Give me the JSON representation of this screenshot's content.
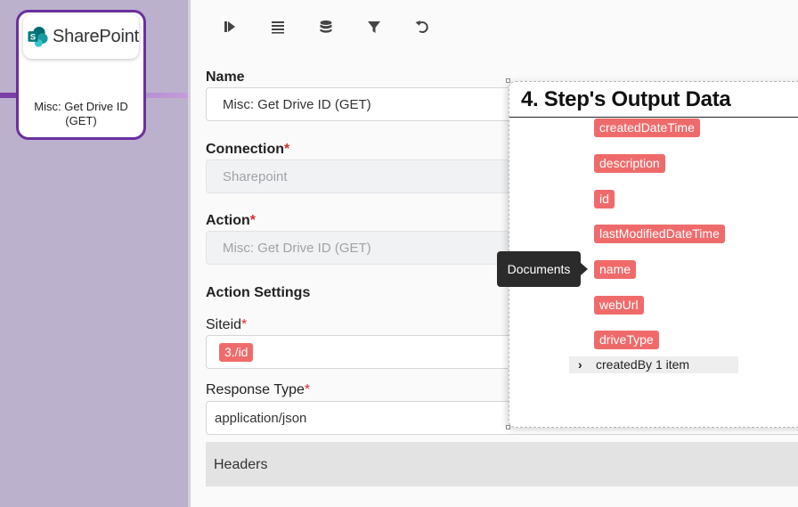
{
  "node": {
    "logo_text": "SharePoint",
    "title": "Misc: Get Drive ID (GET)"
  },
  "toolbar": {
    "icons": [
      "run-step-icon",
      "list-icon",
      "database-icon",
      "filter-icon",
      "undo-icon"
    ]
  },
  "form": {
    "name_label": "Name",
    "name_value": "Misc: Get Drive ID (GET)",
    "connection_label": "Connection",
    "connection_value": "Sharepoint",
    "action_label": "Action",
    "action_value": "Misc: Get Drive ID (GET)",
    "action_settings_label": "Action Settings",
    "siteid_label": "Siteid",
    "siteid_chip": "3./id",
    "response_type_label": "Response Type",
    "response_type_value": "application/json",
    "required_mark": "*",
    "headers_label": "Headers"
  },
  "output_panel": {
    "title": "4. Step's Output Data",
    "fields": [
      "createdDateTime",
      "description",
      "id",
      "lastModifiedDateTime",
      "name",
      "webUrl",
      "driveType"
    ],
    "tree_row_label": "createdBy",
    "tree_row_count": "1 item",
    "tree_caret": "›"
  },
  "tooltip": {
    "text": "Documents"
  },
  "colors": {
    "chip": "#ef6b6b",
    "node_border": "#6a30a0",
    "canvas": "#bcb1cd",
    "required": "#d32f2f"
  }
}
